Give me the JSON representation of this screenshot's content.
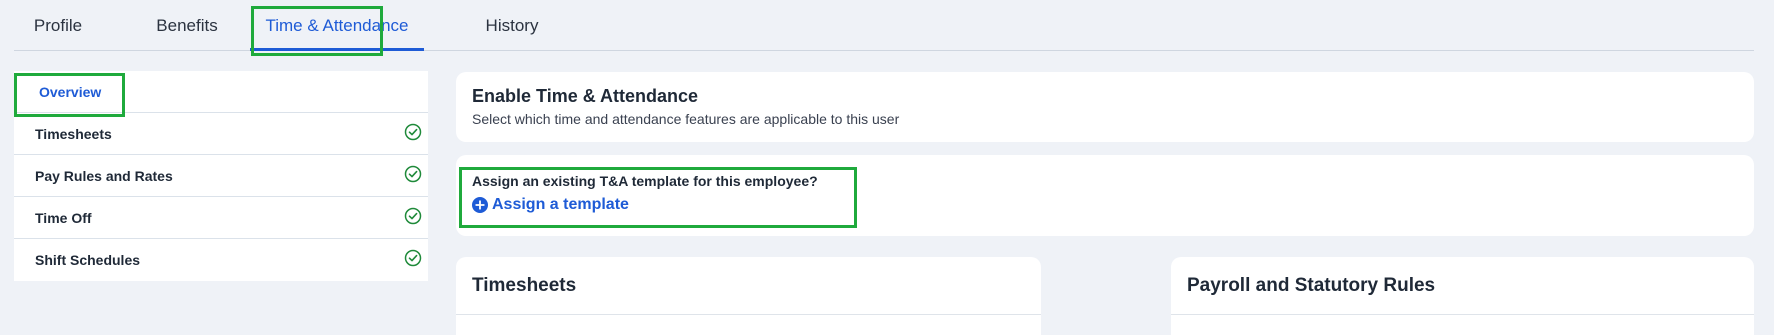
{
  "tabs": [
    {
      "label": "Profile"
    },
    {
      "label": "Benefits"
    },
    {
      "label": "Time & Attendance",
      "active": true
    },
    {
      "label": "History"
    }
  ],
  "sidebar": {
    "items": [
      {
        "label": "Overview",
        "active": true
      },
      {
        "label": "Timesheets",
        "status_icon": "check-circle-icon"
      },
      {
        "label": "Pay Rules and Rates",
        "status_icon": "check-circle-icon"
      },
      {
        "label": "Time Off",
        "status_icon": "check-circle-icon"
      },
      {
        "label": "Shift Schedules",
        "status_icon": "check-circle-icon"
      }
    ]
  },
  "enable_card": {
    "title": "Enable Time & Attendance",
    "subtitle": "Select which time and attendance features are applicable to this user"
  },
  "assign_card": {
    "question": "Assign an existing T&A template for this employee?",
    "link_label": "Assign a template",
    "link_icon": "plus-circle-icon"
  },
  "sections": {
    "timesheets_title": "Timesheets",
    "payroll_title": "Payroll and Statutory Rules"
  },
  "colors": {
    "accent": "#1e5bd6",
    "highlight": "#1faa3c",
    "check": "#1f8a3a",
    "background": "#eff2f7"
  }
}
